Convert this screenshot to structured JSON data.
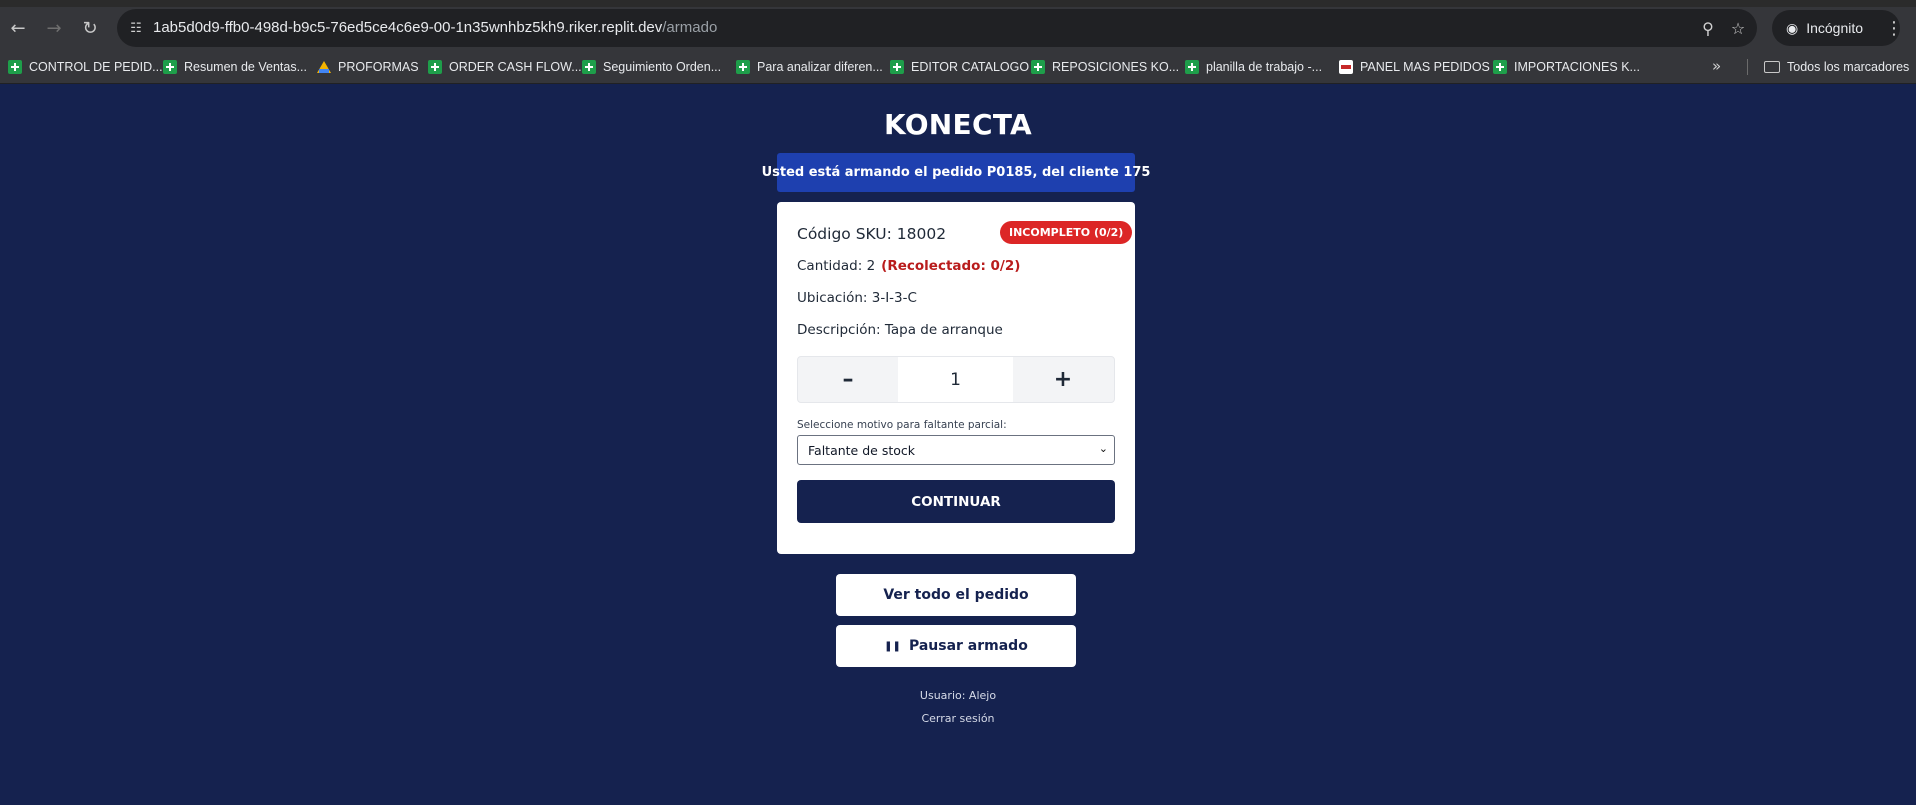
{
  "browser": {
    "url_host": "1ab5d0d9-ffb0-498d-b9c5-76ed5ce4c6e9-00-1n35wnhbz5kh9.riker.replit.dev",
    "url_path": "/armado",
    "profile_label": "Incógnito",
    "bookmarks": [
      {
        "label": "CONTROL DE PEDID...",
        "icon": "sheets-icon"
      },
      {
        "label": "Resumen de Ventas...",
        "icon": "sheets-icon"
      },
      {
        "label": "PROFORMAS",
        "icon": "drive-icon"
      },
      {
        "label": "ORDER CASH FLOW...",
        "icon": "sheets-icon"
      },
      {
        "label": "Seguimiento Orden...",
        "icon": "sheets-icon"
      },
      {
        "label": "Para analizar diferen...",
        "icon": "sheets-icon"
      },
      {
        "label": "EDITOR CATALOGO",
        "icon": "sheets-icon"
      },
      {
        "label": "REPOSICIONES KO...",
        "icon": "sheets-icon"
      },
      {
        "label": "planilla de trabajo -...",
        "icon": "sheets-icon"
      },
      {
        "label": "PANEL MAS PEDIDOS",
        "icon": "panel-icon"
      },
      {
        "label": "IMPORTACIONES K...",
        "icon": "sheets-icon"
      }
    ],
    "all_bookmarks_label": "Todos los marcadores"
  },
  "app": {
    "title": "KONECTA",
    "banner_prefix": "Usted está armando el pedido ",
    "order_id": "P0185",
    "banner_middle": ", del cliente ",
    "client_id": "175"
  },
  "item": {
    "sku_label": "Código SKU:",
    "sku_value": "18002",
    "status_badge": "INCOMPLETO (0/2)",
    "qty_label": "Cantidad:",
    "qty_value": "2",
    "collected_text": "(Recolectado: 0/2)",
    "location_label": "Ubicación:",
    "location_value": "3-I-3-C",
    "desc_label": "Descripción:",
    "desc_value": "Tapa de arranque"
  },
  "stepper": {
    "minus": "–",
    "value": "1",
    "plus": "+"
  },
  "reason": {
    "label": "Seleccione motivo para faltante parcial:",
    "selected": "Faltante de stock"
  },
  "actions": {
    "continue": "CONTINUAR",
    "view_all": "Ver todo el pedido",
    "pause_icon": "pause-icon",
    "pause": "Pausar armado"
  },
  "footer": {
    "user": "Usuario: Alejo",
    "logout": "Cerrar sesión"
  },
  "colors": {
    "background": "#15224f",
    "banner": "#1e40af",
    "badge": "#dc2626",
    "collected": "#b91c1c"
  }
}
